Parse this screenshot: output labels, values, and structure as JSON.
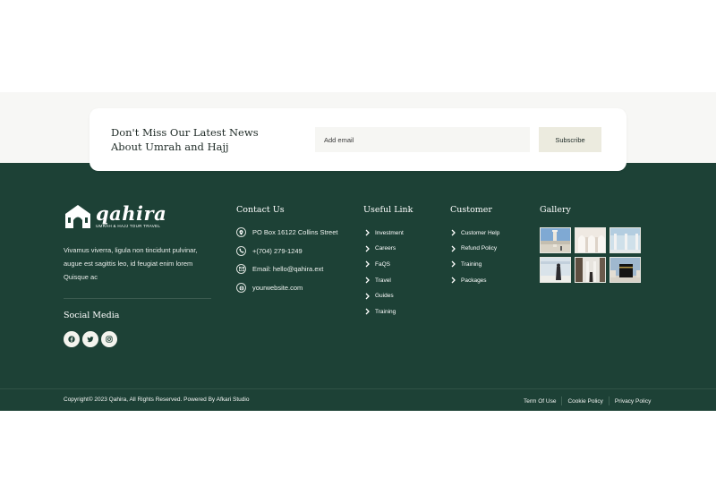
{
  "newsletter": {
    "title_line1": "Don't Miss Our Latest News",
    "title_line2": "About Umrah and Hajj",
    "email_placeholder": "Add email",
    "subscribe_label": "Subscribe"
  },
  "brand": {
    "name": "qahira",
    "tagline": "UMRAH & HAJJ TOUR TRAVEL",
    "about": "Vivamus viverra, ligula non tincidunt pulvinar, augue est sagittis leo, id feugiat enim lorem Quisque ac",
    "social_title": "Social Media",
    "social_icons": [
      "facebook-icon",
      "twitter-icon",
      "instagram-icon"
    ]
  },
  "contact": {
    "title": "Contact Us",
    "items": [
      {
        "icon": "location-pin-icon",
        "text": "PO Box 16122 Collins Street"
      },
      {
        "icon": "phone-icon",
        "text": "+(704) 279-1249"
      },
      {
        "icon": "email-icon",
        "text": "Email: hello@qahira.ext"
      },
      {
        "icon": "globe-icon",
        "text": "yourwebsite.com"
      }
    ]
  },
  "useful_links": {
    "title": "Useful Link",
    "items": [
      "Investment",
      "Careers",
      "FaQS",
      "Travel",
      "Guides",
      "Training"
    ]
  },
  "customer": {
    "title": "Customer",
    "items": [
      "Customer Help",
      "Refund Policy",
      "Training",
      "Packages"
    ]
  },
  "gallery": {
    "title": "Gallery",
    "images": [
      "mosque-tower-photo",
      "white-arches-photo",
      "courtyard-columns-photo",
      "pilgrim-walking-photo",
      "marble-hall-photo",
      "kaaba-photo"
    ]
  },
  "footer": {
    "copyright": "Copyright© 2023 Qahira, All Rights Reserved. Powered By Afkari Studio",
    "links": [
      "Term Of Use",
      "Cookie Policy",
      "Privacy Policy"
    ]
  },
  "colors": {
    "footer_green": "#1d4136",
    "accent_cream": "#ecebdf",
    "band_gray": "#f7f7f5"
  }
}
